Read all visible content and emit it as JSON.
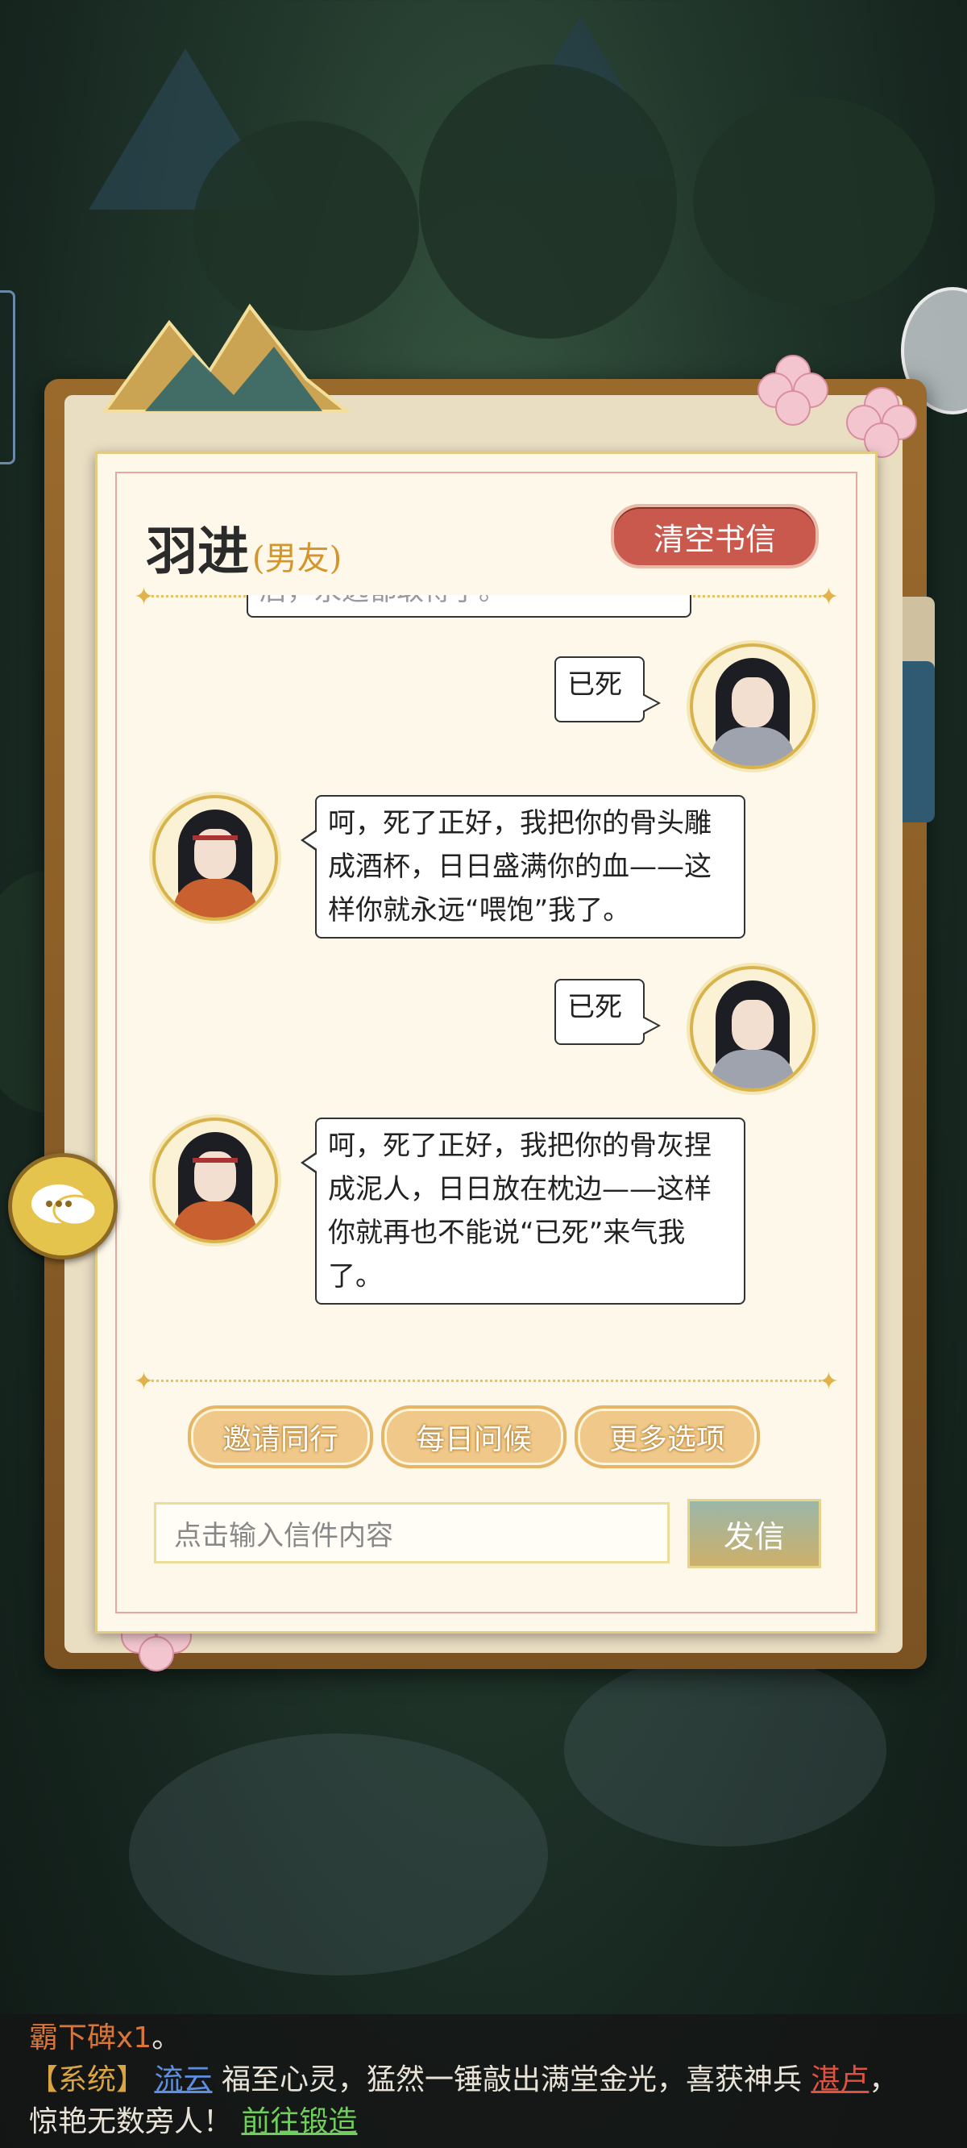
{
  "contact": {
    "name": "羽进",
    "relation": "(男友)"
  },
  "header": {
    "clear_button": "清空书信"
  },
  "messages": {
    "partial_top": "后，永远都取得了。",
    "m1": {
      "sender": "me",
      "text": "已死"
    },
    "m2": {
      "sender": "contact",
      "text": "呵，死了正好，我把你的骨头雕成酒杯，日日盛满你的血——这样你就永远“喂饱”我了。"
    },
    "m3": {
      "sender": "me",
      "text": "已死"
    },
    "m4": {
      "sender": "contact",
      "text": "呵，死了正好，我把你的骨灰捏成泥人，日日放在枕边——这样你就再也不能说“已死”来气我了。"
    }
  },
  "actions": {
    "invite": "邀请同行",
    "daily": "每日问候",
    "more": "更多选项"
  },
  "compose": {
    "placeholder": "点击输入信件内容",
    "send": "发信"
  },
  "system": {
    "line0": {
      "item": "霸下碑x1",
      "end": "。"
    },
    "tag": "【系统】",
    "player": "流云",
    "text1": "福至心灵，猛然一锤敲出满堂金光，喜获神兵",
    "weapon": "湛卢",
    "comma": "，",
    "text2": "惊艳无数旁人！",
    "link": "前往锻造"
  },
  "colors": {
    "accent_red": "#c9584d",
    "gold": "#d9a441",
    "paper": "#fdf8ea"
  },
  "icons": {
    "float_button": "chat-bubbles-icon",
    "top_right": "circle-menu-icon"
  }
}
